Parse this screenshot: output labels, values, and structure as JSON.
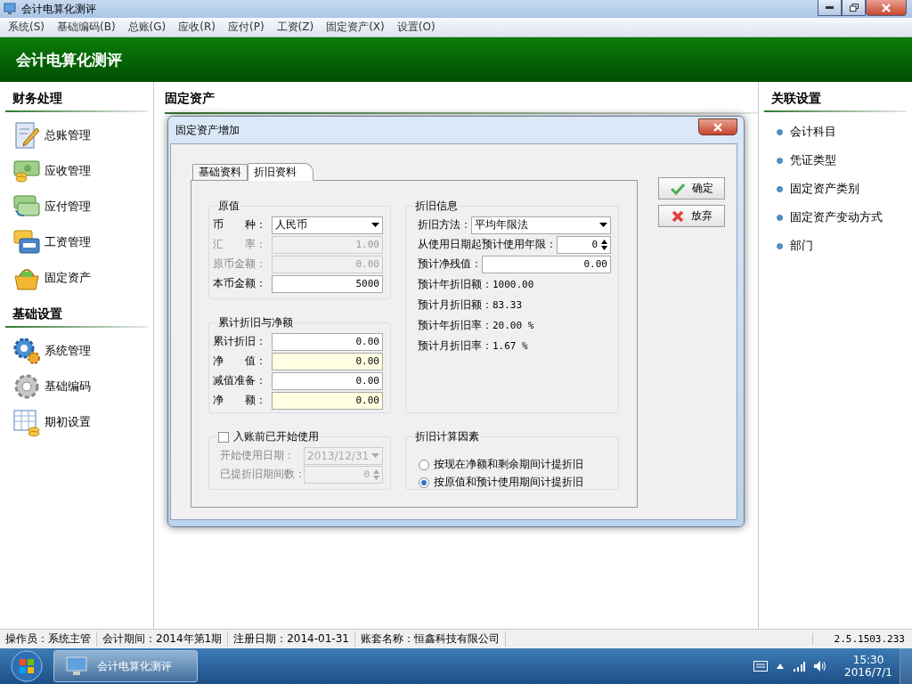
{
  "window": {
    "title": "会计电算化测评"
  },
  "menu": [
    "系统(S)",
    "基础编码(B)",
    "总账(G)",
    "应收(R)",
    "应付(P)",
    "工资(Z)",
    "固定资产(X)",
    "设置(O)"
  ],
  "header": {
    "title": "会计电算化测评"
  },
  "sidebar": [
    {
      "title": "财务处理",
      "items": [
        {
          "label": "总账管理",
          "kind": "notebook"
        },
        {
          "label": "应收管理",
          "kind": "cash"
        },
        {
          "label": "应付管理",
          "kind": "transfer"
        },
        {
          "label": "工资管理",
          "kind": "card"
        },
        {
          "label": "固定资产",
          "kind": "basket"
        }
      ]
    },
    {
      "title": "基础设置",
      "items": [
        {
          "label": "系统管理",
          "kind": "gears"
        },
        {
          "label": "基础编码",
          "kind": "gear"
        },
        {
          "label": "期初设置",
          "kind": "table"
        }
      ]
    }
  ],
  "content": {
    "title": "固定资产"
  },
  "related": {
    "title": "关联设置",
    "items": [
      "会计科目",
      "凭证类型",
      "固定资产类别",
      "固定资产变动方式",
      "部门"
    ]
  },
  "dialog": {
    "title": "固定资产增加",
    "tabs": [
      {
        "label": "基础资料",
        "selected": false
      },
      {
        "label": "折旧资料",
        "selected": true
      }
    ],
    "original_value": {
      "title": "原值",
      "fields": [
        {
          "label": "币　　种：",
          "value": "人民币",
          "kind": "select",
          "disabled": false,
          "readonly": false
        },
        {
          "label": "汇　　率：",
          "value": "1.00",
          "kind": "text",
          "disabled": true,
          "readonly": false
        },
        {
          "label": "原币金额：",
          "value": "0.00",
          "kind": "text",
          "disabled": true,
          "readonly": false
        },
        {
          "label": "本币金额：",
          "value": "5000",
          "kind": "text",
          "disabled": false,
          "readonly": false
        }
      ]
    },
    "accumulated": {
      "title": "累计折旧与净额",
      "fields": [
        {
          "label": "累计折旧：",
          "value": "0.00",
          "kind": "text",
          "disabled": false,
          "readonly": false
        },
        {
          "label": "净　　值：",
          "value": "0.00",
          "kind": "text",
          "disabled": false,
          "readonly": true
        },
        {
          "label": "减值准备：",
          "value": "0.00",
          "kind": "text",
          "disabled": false,
          "readonly": false
        },
        {
          "label": "净　　额：",
          "value": "0.00",
          "kind": "text",
          "disabled": false,
          "readonly": true
        }
      ]
    },
    "pre_use": {
      "title": "入账前已开始使用",
      "checked": false,
      "fields": [
        {
          "label": "开始使用日期：",
          "value": "2013/12/31",
          "kind": "select",
          "disabled": true,
          "readonly": false
        },
        {
          "label": "已提折旧期间数：",
          "value": "0",
          "kind": "spin",
          "disabled": true,
          "readonly": false
        }
      ]
    },
    "depreciation": {
      "title": "折旧信息",
      "fields": [
        {
          "label": "折旧方法：",
          "value": "平均年限法",
          "kind": "select",
          "disabled": false,
          "readonly": false
        },
        {
          "label": "从使用日期起预计使用年限：",
          "value": "0",
          "kind": "spin",
          "disabled": false,
          "readonly": false
        },
        {
          "label": "预计净残值：",
          "value": "0.00",
          "kind": "text",
          "disabled": false,
          "readonly": false
        }
      ],
      "stats": [
        {
          "label": "预计年折旧额：",
          "value": "1000.00"
        },
        {
          "label": "预计月折旧额：",
          "value": "83.33"
        },
        {
          "label": "预计年折旧率：",
          "value": "20.00 %"
        },
        {
          "label": "预计月折旧率：",
          "value": "1.67 %"
        }
      ]
    },
    "factors": {
      "title": "折旧计算因素",
      "options": [
        {
          "label": "按现在净额和剩余期间计提折旧",
          "selected": false
        },
        {
          "label": "按原值和预计使用期间计提折旧",
          "selected": true
        }
      ]
    },
    "buttons": [
      {
        "label": "确定",
        "kind": "ok"
      },
      {
        "label": "放弃",
        "kind": "cancel"
      }
    ]
  },
  "status_bar": {
    "items": [
      "操作员：系统主管",
      "会计期间：2014年第1期",
      "注册日期：2014-01-31",
      "账套名称：恒鑫科技有限公司"
    ],
    "version": "2.5.1503.233"
  },
  "taskbar": {
    "app": "会计电算化测评",
    "time": "15:30",
    "date": "2016/7/1"
  }
}
